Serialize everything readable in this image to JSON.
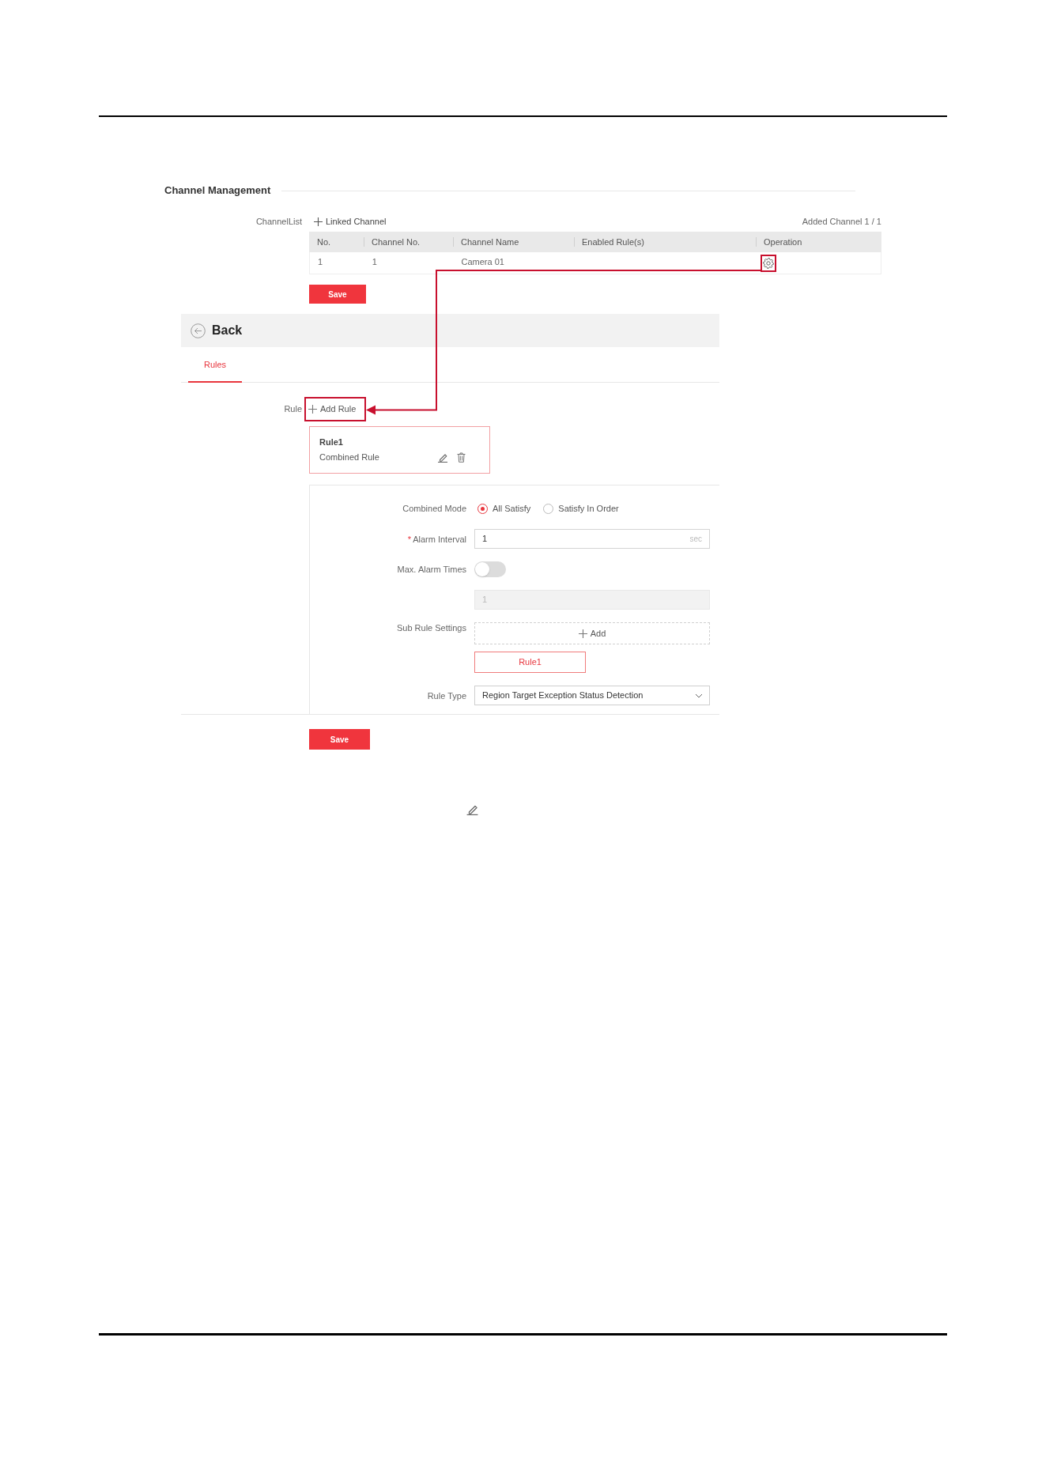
{
  "channel_management": {
    "title": "Channel Management",
    "list_label": "ChannelList",
    "link_button": "Linked Channel",
    "added_count": "Added Channel 1 / 1",
    "table": {
      "columns": [
        "No.",
        "Channel No.",
        "Channel Name",
        "Enabled Rule(s)",
        "Operation"
      ],
      "rows": [
        {
          "cells": [
            "1",
            "1",
            "Camera 01"
          ],
          "operation_highlighted": true
        }
      ]
    },
    "save_button": "Save"
  },
  "rule_page": {
    "back_button": "Back",
    "tabs": [
      {
        "label": "Rules",
        "selected": true
      }
    ],
    "rule_label": "Rule",
    "add_rule": {
      "label": "Add Rule",
      "highlighted": true
    },
    "rule_cards": [
      {
        "title": "Rule1",
        "type": "Combined Rule",
        "selected": true
      }
    ],
    "form": {
      "fields": [
        {
          "kind": "radio",
          "label": "Combined Mode",
          "options": [
            {
              "label": "All Satisfy",
              "selected": true
            },
            {
              "label": "Satisfy In Order",
              "selected": false
            }
          ]
        },
        {
          "kind": "input",
          "label": "Alarm Interval",
          "required_mark": "*",
          "value": "1",
          "unit": "sec",
          "disabled": false
        },
        {
          "kind": "toggle",
          "label": "Max. Alarm Times",
          "on": false
        },
        {
          "kind": "input",
          "value": "1",
          "disabled": true
        },
        {
          "kind": "sub_rules",
          "label": "Sub Rule Settings",
          "add_label": "Add",
          "rules": [
            {
              "label": "Rule1",
              "selected": true
            }
          ]
        },
        {
          "kind": "select",
          "label": "Rule Type",
          "value": "Region Target Exception Status Detection"
        }
      ]
    },
    "save_button": "Save"
  }
}
